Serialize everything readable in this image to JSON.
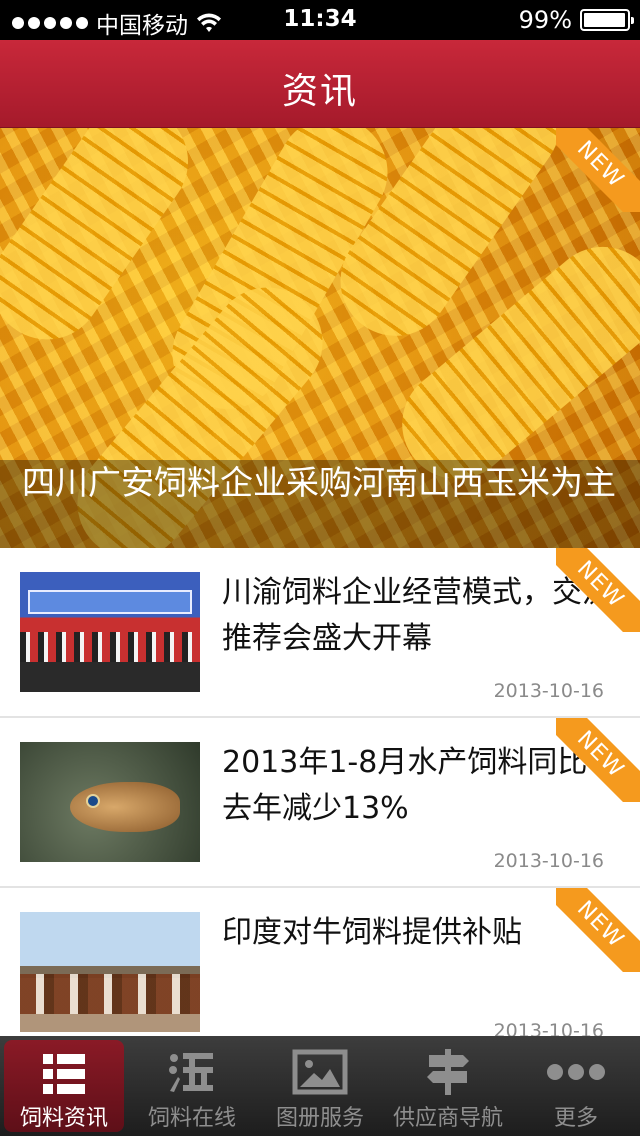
{
  "status_bar": {
    "carrier": "中国移动",
    "time": "11:34",
    "battery": "99%",
    "battery_level": 0.99
  },
  "nav": {
    "title": "资讯"
  },
  "hero": {
    "caption": "四川广安饲料企业采购河南山西玉米为主",
    "badge": "NEW"
  },
  "news": [
    {
      "title": "川渝饲料企业经营模式，交流推荐会盛大开幕",
      "date": "2013-10-16",
      "badge": "NEW"
    },
    {
      "title": "2013年1-8月水产饲料同比去年减少13%",
      "date": "2013-10-16",
      "badge": "NEW"
    },
    {
      "title": "印度对牛饲料提供补贴",
      "date": "2013-10-16",
      "badge": "NEW"
    }
  ],
  "tabs": [
    {
      "label": "饲料资讯",
      "icon": "list-icon",
      "active": true
    },
    {
      "label": "饲料在线",
      "icon": "taobao-icon",
      "active": false
    },
    {
      "label": "图册服务",
      "icon": "image-icon",
      "active": false
    },
    {
      "label": "供应商导航",
      "icon": "signpost-icon",
      "active": false
    },
    {
      "label": "更多",
      "icon": "more-icon",
      "active": false
    }
  ]
}
